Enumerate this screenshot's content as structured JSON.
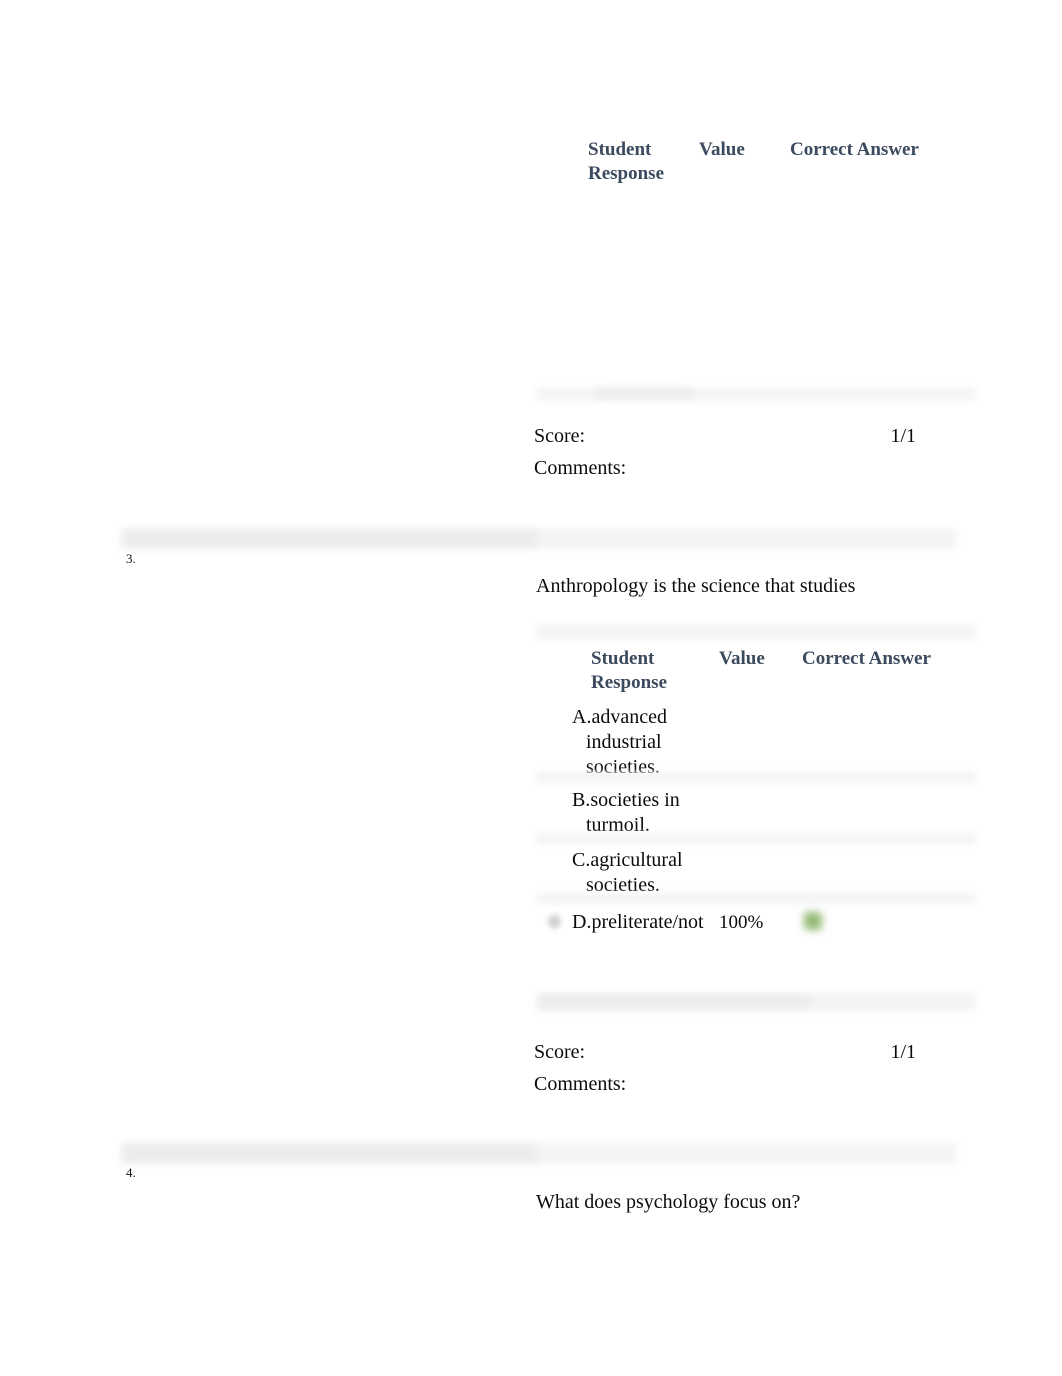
{
  "document": {
    "type": "quiz-results-review"
  },
  "table_headers": {
    "student_response": "Student\nResponse",
    "value": "Value",
    "correct_answer": "Correct Answer"
  },
  "questions": [
    {
      "number": "",
      "stem": "",
      "options": [],
      "score_label": "Score:",
      "score_value": "1/1",
      "comments_label": "Comments:",
      "comments_value": ""
    },
    {
      "number": "3.",
      "stem": "Anthropology is the science that studies",
      "options": [
        {
          "label": "A.advanced\nindustrial\nsocieties.",
          "value": "",
          "selected": false,
          "correct": false
        },
        {
          "label": "B.societies in\nturmoil.",
          "value": "",
          "selected": false,
          "correct": false
        },
        {
          "label": "C.agricultural\nsocieties.",
          "value": "",
          "selected": false,
          "correct": false
        },
        {
          "label": "D.preliterate/not",
          "value": "100%",
          "selected": true,
          "correct": true
        }
      ],
      "score_label": "Score:",
      "score_value": "1/1",
      "comments_label": "Comments:",
      "comments_value": ""
    },
    {
      "number": "4.",
      "stem": "What does psychology focus on?",
      "options": [],
      "score_label": "",
      "score_value": "",
      "comments_label": "",
      "comments_value": ""
    }
  ],
  "icons": {
    "selected_radio": "selected-radio-icon",
    "correct_check": "green-check-icon"
  },
  "colors": {
    "header_text": "#3c4a5e",
    "body_text": "#0b0b0b",
    "separator_band": "#f2f2f4",
    "correct_green": "#87ae63"
  }
}
